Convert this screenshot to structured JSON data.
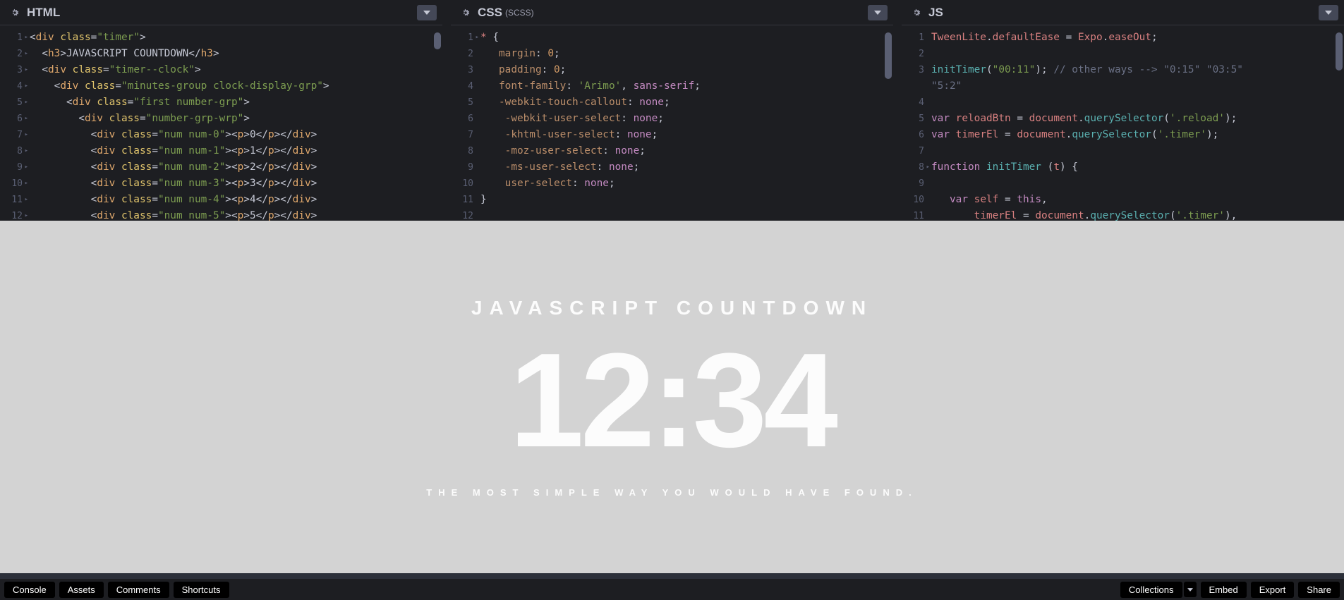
{
  "editors": {
    "html": {
      "title": "HTML",
      "lines": [
        [
          [
            "t-punct",
            "<"
          ],
          [
            "t-tag",
            "div"
          ],
          [
            "t-plain",
            " "
          ],
          [
            "t-attr",
            "class"
          ],
          [
            "t-punct",
            "="
          ],
          [
            "t-str",
            "\"timer\""
          ],
          [
            "t-punct",
            ">"
          ]
        ],
        [
          [
            "t-plain",
            "  "
          ],
          [
            "t-punct",
            "<"
          ],
          [
            "t-tag",
            "h3"
          ],
          [
            "t-punct",
            ">"
          ],
          [
            "t-txt",
            "JAVASCRIPT COUNTDOWN"
          ],
          [
            "t-punct",
            "</"
          ],
          [
            "t-tag",
            "h3"
          ],
          [
            "t-punct",
            ">"
          ]
        ],
        [
          [
            "t-plain",
            "  "
          ],
          [
            "t-punct",
            "<"
          ],
          [
            "t-tag",
            "div"
          ],
          [
            "t-plain",
            " "
          ],
          [
            "t-attr",
            "class"
          ],
          [
            "t-punct",
            "="
          ],
          [
            "t-str",
            "\"timer--clock\""
          ],
          [
            "t-punct",
            ">"
          ]
        ],
        [
          [
            "t-plain",
            "    "
          ],
          [
            "t-punct",
            "<"
          ],
          [
            "t-tag",
            "div"
          ],
          [
            "t-plain",
            " "
          ],
          [
            "t-attr",
            "class"
          ],
          [
            "t-punct",
            "="
          ],
          [
            "t-str",
            "\"minutes-group clock-display-grp\""
          ],
          [
            "t-punct",
            ">"
          ]
        ],
        [
          [
            "t-plain",
            "      "
          ],
          [
            "t-punct",
            "<"
          ],
          [
            "t-tag",
            "div"
          ],
          [
            "t-plain",
            " "
          ],
          [
            "t-attr",
            "class"
          ],
          [
            "t-punct",
            "="
          ],
          [
            "t-str",
            "\"first number-grp\""
          ],
          [
            "t-punct",
            ">"
          ]
        ],
        [
          [
            "t-plain",
            "        "
          ],
          [
            "t-punct",
            "<"
          ],
          [
            "t-tag",
            "div"
          ],
          [
            "t-plain",
            " "
          ],
          [
            "t-attr",
            "class"
          ],
          [
            "t-punct",
            "="
          ],
          [
            "t-str",
            "\"number-grp-wrp\""
          ],
          [
            "t-punct",
            ">"
          ]
        ],
        [
          [
            "t-plain",
            "          "
          ],
          [
            "t-punct",
            "<"
          ],
          [
            "t-tag",
            "div"
          ],
          [
            "t-plain",
            " "
          ],
          [
            "t-attr",
            "class"
          ],
          [
            "t-punct",
            "="
          ],
          [
            "t-str",
            "\"num num-0\""
          ],
          [
            "t-punct",
            "><"
          ],
          [
            "t-tag",
            "p"
          ],
          [
            "t-punct",
            ">"
          ],
          [
            "t-txt",
            "0"
          ],
          [
            "t-punct",
            "</"
          ],
          [
            "t-tag",
            "p"
          ],
          [
            "t-punct",
            "></"
          ],
          [
            "t-tag",
            "div"
          ],
          [
            "t-punct",
            ">"
          ]
        ],
        [
          [
            "t-plain",
            "          "
          ],
          [
            "t-punct",
            "<"
          ],
          [
            "t-tag",
            "div"
          ],
          [
            "t-plain",
            " "
          ],
          [
            "t-attr",
            "class"
          ],
          [
            "t-punct",
            "="
          ],
          [
            "t-str",
            "\"num num-1\""
          ],
          [
            "t-punct",
            "><"
          ],
          [
            "t-tag",
            "p"
          ],
          [
            "t-punct",
            ">"
          ],
          [
            "t-txt",
            "1"
          ],
          [
            "t-punct",
            "</"
          ],
          [
            "t-tag",
            "p"
          ],
          [
            "t-punct",
            "></"
          ],
          [
            "t-tag",
            "div"
          ],
          [
            "t-punct",
            ">"
          ]
        ],
        [
          [
            "t-plain",
            "          "
          ],
          [
            "t-punct",
            "<"
          ],
          [
            "t-tag",
            "div"
          ],
          [
            "t-plain",
            " "
          ],
          [
            "t-attr",
            "class"
          ],
          [
            "t-punct",
            "="
          ],
          [
            "t-str",
            "\"num num-2\""
          ],
          [
            "t-punct",
            "><"
          ],
          [
            "t-tag",
            "p"
          ],
          [
            "t-punct",
            ">"
          ],
          [
            "t-txt",
            "2"
          ],
          [
            "t-punct",
            "</"
          ],
          [
            "t-tag",
            "p"
          ],
          [
            "t-punct",
            "></"
          ],
          [
            "t-tag",
            "div"
          ],
          [
            "t-punct",
            ">"
          ]
        ],
        [
          [
            "t-plain",
            "          "
          ],
          [
            "t-punct",
            "<"
          ],
          [
            "t-tag",
            "div"
          ],
          [
            "t-plain",
            " "
          ],
          [
            "t-attr",
            "class"
          ],
          [
            "t-punct",
            "="
          ],
          [
            "t-str",
            "\"num num-3\""
          ],
          [
            "t-punct",
            "><"
          ],
          [
            "t-tag",
            "p"
          ],
          [
            "t-punct",
            ">"
          ],
          [
            "t-txt",
            "3"
          ],
          [
            "t-punct",
            "</"
          ],
          [
            "t-tag",
            "p"
          ],
          [
            "t-punct",
            "></"
          ],
          [
            "t-tag",
            "div"
          ],
          [
            "t-punct",
            ">"
          ]
        ],
        [
          [
            "t-plain",
            "          "
          ],
          [
            "t-punct",
            "<"
          ],
          [
            "t-tag",
            "div"
          ],
          [
            "t-plain",
            " "
          ],
          [
            "t-attr",
            "class"
          ],
          [
            "t-punct",
            "="
          ],
          [
            "t-str",
            "\"num num-4\""
          ],
          [
            "t-punct",
            "><"
          ],
          [
            "t-tag",
            "p"
          ],
          [
            "t-punct",
            ">"
          ],
          [
            "t-txt",
            "4"
          ],
          [
            "t-punct",
            "</"
          ],
          [
            "t-tag",
            "p"
          ],
          [
            "t-punct",
            "></"
          ],
          [
            "t-tag",
            "div"
          ],
          [
            "t-punct",
            ">"
          ]
        ],
        [
          [
            "t-plain",
            "          "
          ],
          [
            "t-punct",
            "<"
          ],
          [
            "t-tag",
            "div"
          ],
          [
            "t-plain",
            " "
          ],
          [
            "t-attr",
            "class"
          ],
          [
            "t-punct",
            "="
          ],
          [
            "t-str",
            "\"num num-5\""
          ],
          [
            "t-punct",
            "><"
          ],
          [
            "t-tag",
            "p"
          ],
          [
            "t-punct",
            ">"
          ],
          [
            "t-txt",
            "5"
          ],
          [
            "t-punct",
            "</"
          ],
          [
            "t-tag",
            "p"
          ],
          [
            "t-punct",
            "></"
          ],
          [
            "t-tag",
            "div"
          ],
          [
            "t-punct",
            ">"
          ]
        ]
      ],
      "fold_lines": [
        1,
        2,
        3,
        4,
        5,
        6,
        7,
        8,
        9,
        10,
        11,
        12
      ]
    },
    "css": {
      "title": "CSS",
      "subtype": "(SCSS)",
      "lines": [
        [
          [
            "t-sel",
            "*"
          ],
          [
            "t-plain",
            " "
          ],
          [
            "t-punct",
            "{"
          ]
        ],
        [
          [
            "t-plain",
            "   "
          ],
          [
            "t-prop",
            "margin"
          ],
          [
            "t-punct",
            ": "
          ],
          [
            "t-num",
            "0"
          ],
          [
            "t-punct",
            ";"
          ]
        ],
        [
          [
            "t-plain",
            "   "
          ],
          [
            "t-prop",
            "padding"
          ],
          [
            "t-punct",
            ": "
          ],
          [
            "t-num",
            "0"
          ],
          [
            "t-punct",
            ";"
          ]
        ],
        [
          [
            "t-plain",
            "   "
          ],
          [
            "t-prop",
            "font-family"
          ],
          [
            "t-punct",
            ": "
          ],
          [
            "t-str",
            "'Arimo'"
          ],
          [
            "t-punct",
            ", "
          ],
          [
            "t-kw",
            "sans-serif"
          ],
          [
            "t-punct",
            ";"
          ]
        ],
        [
          [
            "t-plain",
            "   "
          ],
          [
            "t-prop",
            "-webkit-touch-callout"
          ],
          [
            "t-punct",
            ": "
          ],
          [
            "t-kw",
            "none"
          ],
          [
            "t-punct",
            ";"
          ]
        ],
        [
          [
            "t-plain",
            "    "
          ],
          [
            "t-prop",
            "-webkit-user-select"
          ],
          [
            "t-punct",
            ": "
          ],
          [
            "t-kw",
            "none"
          ],
          [
            "t-punct",
            ";"
          ]
        ],
        [
          [
            "t-plain",
            "    "
          ],
          [
            "t-prop",
            "-khtml-user-select"
          ],
          [
            "t-punct",
            ": "
          ],
          [
            "t-kw",
            "none"
          ],
          [
            "t-punct",
            ";"
          ]
        ],
        [
          [
            "t-plain",
            "    "
          ],
          [
            "t-prop",
            "-moz-user-select"
          ],
          [
            "t-punct",
            ": "
          ],
          [
            "t-kw",
            "none"
          ],
          [
            "t-punct",
            ";"
          ]
        ],
        [
          [
            "t-plain",
            "    "
          ],
          [
            "t-prop",
            "-ms-user-select"
          ],
          [
            "t-punct",
            ": "
          ],
          [
            "t-kw",
            "none"
          ],
          [
            "t-punct",
            ";"
          ]
        ],
        [
          [
            "t-plain",
            "    "
          ],
          [
            "t-prop",
            "user-select"
          ],
          [
            "t-punct",
            ": "
          ],
          [
            "t-kw",
            "none"
          ],
          [
            "t-punct",
            ";"
          ]
        ],
        [
          [
            "t-punct",
            "}"
          ]
        ],
        [
          [
            "t-plain",
            ""
          ]
        ]
      ]
    },
    "js": {
      "title": "JS",
      "lines": [
        [
          [
            "t-var",
            "TweenLite"
          ],
          [
            "t-punct",
            "."
          ],
          [
            "t-var",
            "defaultEase"
          ],
          [
            "t-plain",
            " "
          ],
          [
            "t-op",
            "="
          ],
          [
            "t-plain",
            " "
          ],
          [
            "t-var",
            "Expo"
          ],
          [
            "t-punct",
            "."
          ],
          [
            "t-var",
            "easeOut"
          ],
          [
            "t-punct",
            ";"
          ]
        ],
        [
          [
            "t-plain",
            ""
          ]
        ],
        [
          [
            "t-fn",
            "initTimer"
          ],
          [
            "t-punct",
            "("
          ],
          [
            "t-str",
            "\"00:11\""
          ],
          [
            "t-punct",
            "); "
          ],
          [
            "t-com",
            "// other ways --> \"0:15\" \"03:5\""
          ]
        ],
        [
          [
            "t-com",
            "\"5:2\""
          ]
        ],
        [
          [
            "t-plain",
            ""
          ]
        ],
        [
          [
            "t-kw",
            "var"
          ],
          [
            "t-plain",
            " "
          ],
          [
            "t-var",
            "reloadBtn"
          ],
          [
            "t-plain",
            " "
          ],
          [
            "t-op",
            "="
          ],
          [
            "t-plain",
            " "
          ],
          [
            "t-var",
            "document"
          ],
          [
            "t-punct",
            "."
          ],
          [
            "t-fn",
            "querySelector"
          ],
          [
            "t-punct",
            "("
          ],
          [
            "t-str",
            "'.reload'"
          ],
          [
            "t-punct",
            ");"
          ]
        ],
        [
          [
            "t-kw",
            "var"
          ],
          [
            "t-plain",
            " "
          ],
          [
            "t-var",
            "timerEl"
          ],
          [
            "t-plain",
            " "
          ],
          [
            "t-op",
            "="
          ],
          [
            "t-plain",
            " "
          ],
          [
            "t-var",
            "document"
          ],
          [
            "t-punct",
            "."
          ],
          [
            "t-fn",
            "querySelector"
          ],
          [
            "t-punct",
            "("
          ],
          [
            "t-str",
            "'.timer'"
          ],
          [
            "t-punct",
            ");"
          ]
        ],
        [
          [
            "t-plain",
            ""
          ]
        ],
        [
          [
            "t-kw",
            "function"
          ],
          [
            "t-plain",
            " "
          ],
          [
            "t-fn",
            "initTimer"
          ],
          [
            "t-plain",
            " "
          ],
          [
            "t-punct",
            "("
          ],
          [
            "t-var",
            "t"
          ],
          [
            "t-punct",
            ") {"
          ]
        ],
        [
          [
            "t-plain",
            ""
          ]
        ],
        [
          [
            "t-plain",
            "   "
          ],
          [
            "t-kw",
            "var"
          ],
          [
            "t-plain",
            " "
          ],
          [
            "t-var",
            "self"
          ],
          [
            "t-plain",
            " "
          ],
          [
            "t-op",
            "="
          ],
          [
            "t-plain",
            " "
          ],
          [
            "t-kw",
            "this"
          ],
          [
            "t-punct",
            ","
          ]
        ],
        [
          [
            "t-plain",
            "       "
          ],
          [
            "t-var",
            "timerEl"
          ],
          [
            "t-plain",
            " "
          ],
          [
            "t-op",
            "="
          ],
          [
            "t-plain",
            " "
          ],
          [
            "t-var",
            "document"
          ],
          [
            "t-punct",
            "."
          ],
          [
            "t-fn",
            "querySelector"
          ],
          [
            "t-punct",
            "("
          ],
          [
            "t-str",
            "'.timer'"
          ],
          [
            "t-punct",
            "),"
          ]
        ]
      ],
      "fold_lines_at": [
        8
      ]
    }
  },
  "preview": {
    "title": "JAVASCRIPT COUNTDOWN",
    "countdown": "12:34",
    "subtitle": "THE MOST SIMPLE WAY YOU WOULD HAVE FOUND."
  },
  "footer": {
    "left": [
      "Console",
      "Assets",
      "Comments",
      "Shortcuts"
    ],
    "right": [
      "Collections",
      "Embed",
      "Export",
      "Share"
    ]
  }
}
